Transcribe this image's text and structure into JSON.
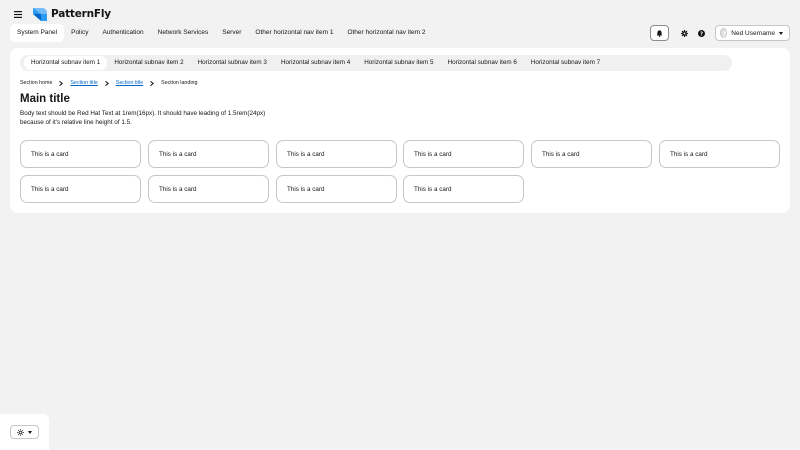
{
  "masthead": {
    "brand_name": "PatternFly",
    "brand_color": "#2b9af3",
    "hamburger_icon": "bars-icon",
    "nav_items": [
      {
        "label": "System Panel",
        "active": true
      },
      {
        "label": "Policy"
      },
      {
        "label": "Authentication"
      },
      {
        "label": "Network Services"
      },
      {
        "label": "Server"
      },
      {
        "label": "Other horizontal nav item 1"
      },
      {
        "label": "Other horizontal nav item 2"
      }
    ],
    "tools": {
      "notification_icon": "bell-icon",
      "settings_icon": "gear-icon",
      "help_icon": "question-circle-icon"
    },
    "user": {
      "name": "Ned Username",
      "avatar_icon": "avatar-icon",
      "caret_icon": "caret-down-icon"
    }
  },
  "subnav": {
    "items": [
      {
        "label": "Horizontal subnav item 1",
        "active": true
      },
      {
        "label": "Horizontal subnav item 2"
      },
      {
        "label": "Horizontal subnav item 3"
      },
      {
        "label": "Horizontal subnav item 4"
      },
      {
        "label": "Horizontal subnav item 5"
      },
      {
        "label": "Horizontal subnav item 6"
      },
      {
        "label": "Horizontal subnav item 7"
      }
    ]
  },
  "breadcrumb": {
    "items": [
      {
        "label": "Section home",
        "link": false
      },
      {
        "label": "Section title",
        "link": true
      },
      {
        "label": "Section title",
        "link": true
      },
      {
        "label": "Section landing",
        "link": false
      }
    ],
    "separator_icon": "angle-right-icon"
  },
  "main": {
    "title": "Main title",
    "body": "Body text should be Red Hat Text at 1rem(16px). It should have leading of 1.5rem(24px) because of it's relative line height of 1.5.",
    "cards": [
      "This is a card",
      "This is a card",
      "This is a card",
      "This is a card",
      "This is a card",
      "This is a card",
      "This is a card",
      "This is a card",
      "This is a card",
      "This is a card"
    ]
  },
  "theme_switcher": {
    "icon": "sun-icon",
    "caret_icon": "caret-down-icon"
  },
  "colors": {
    "link": "#0066cc",
    "page_background": "#f2f2f2",
    "text": "#151515"
  }
}
